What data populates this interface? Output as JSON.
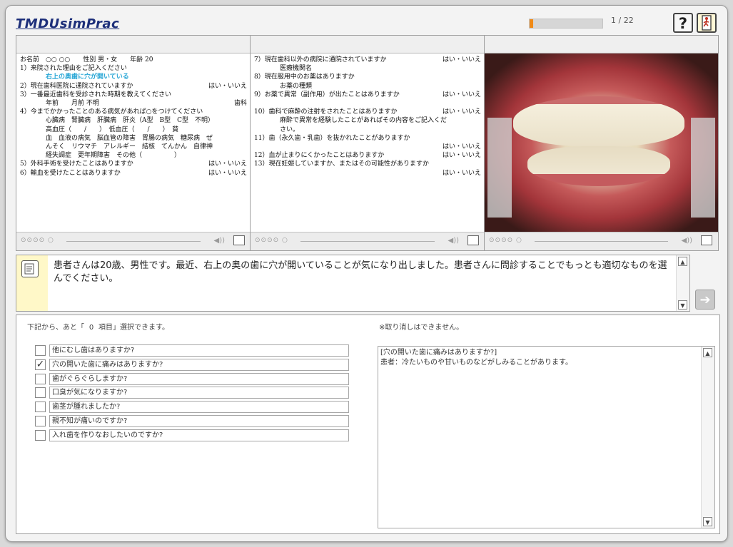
{
  "app": {
    "logo": "TMDUsimPrac",
    "progress_fraction": 0.045,
    "page_counter": "1 / 22",
    "help_icon": "?",
    "exit_icon": "exit-door-icon"
  },
  "media": {
    "controls_glyphs": "⊙⊙⊙⊙ ○",
    "volume_glyph": "◀))",
    "panels": [
      {
        "form_lines": [
          {
            "text": "お名前　○○ ○○　　性別 男・女　　年齢 20"
          },
          {
            "text": "1）来院された理由をご記入ください"
          },
          {
            "text": "右上の奥歯に穴が開いている",
            "hand": true,
            "indent": true
          },
          {
            "text": "2）現在歯科医院に通院されていますか",
            "right": "はい・いいえ"
          },
          {
            "text": "3）一番最近歯科を受診された時期を教えてください"
          },
          {
            "text": "年前　　月前 不明",
            "indent": true,
            "right": "歯科"
          },
          {
            "text": "4）今までかかったことのある病気があれば○をつけてください"
          },
          {
            "text": "心臓病　腎臓病　肝臓病　肝炎（A型　B型　C型　不明）",
            "indent": true
          },
          {
            "text": "高血圧（　　/　　）　低血圧（　　/　　）　貧",
            "indent": true
          },
          {
            "text": "血　血液の病気　脳血管の障害　胃腸の病気　糖尿病　ぜ",
            "indent": true
          },
          {
            "text": "んそく　リウマチ　アレルギー　結核　てんかん　自律神",
            "indent": true
          },
          {
            "text": "経失調症　更年期障害　その他（　　　　　）",
            "indent": true
          },
          {
            "text": "5）外科手術を受けたことはありますか",
            "right": "はい・いいえ"
          },
          {
            "text": "6）輸血を受けたことはありますか",
            "right": "はい・いいえ"
          }
        ]
      },
      {
        "form_lines": [
          {
            "text": "7）現在歯科以外の病院に通院されていますか",
            "right": "はい・いいえ"
          },
          {
            "text": "医療機関名",
            "indent": true
          },
          {
            "text": "8）現在服用中のお薬はありますか"
          },
          {
            "text": "お薬の種類",
            "indent": true
          },
          {
            "text": "9）お薬で異常（副作用）が出たことはありますか",
            "right": "はい・いいえ"
          },
          {
            "text": ""
          },
          {
            "text": "10）歯科で麻酔の注射をされたことはありますか",
            "right": "はい・いいえ"
          },
          {
            "text": "麻酔で異常を経験したことがあればその内容をご記入くだ",
            "indent": true
          },
          {
            "text": "さい。",
            "indent": true
          },
          {
            "text": "11）歯（永久歯・乳歯）を抜かれたことがありますか"
          },
          {
            "text": "",
            "right": "はい・いいえ"
          },
          {
            "text": "12）血が止まりにくかったことはありますか",
            "right": "はい・いいえ"
          },
          {
            "text": "13）現在妊娠していますか、またはその可能性がありますか"
          },
          {
            "text": "",
            "right": "はい・いいえ"
          }
        ]
      }
    ]
  },
  "instruction": {
    "text": "患者さんは20歳、男性です。最近、右上の奥の歯に穴が開いていることが気になり出しました。患者さんに問診することでもっとも適切なものを選んでください。",
    "next_glyph": "➔"
  },
  "selection": {
    "remaining_prefix": "下記から、あと「",
    "remaining_count": "0",
    "remaining_suffix": "項目」選択できます。",
    "notice": "※取り消しはできません。",
    "options": [
      {
        "label": "他にむし歯はありますか?",
        "checked": false
      },
      {
        "label": "穴の開いた歯に痛みはありますか?",
        "checked": true
      },
      {
        "label": "歯がぐらぐらしますか?",
        "checked": false
      },
      {
        "label": "口臭が気になりますか?",
        "checked": false
      },
      {
        "label": "歯茎が腫れましたか?",
        "checked": false
      },
      {
        "label": "親不知が痛いのですか?",
        "checked": false
      },
      {
        "label": "入れ歯を作りなおしたいのですか?",
        "checked": false
      }
    ],
    "log": {
      "question": "[穴の開いた歯に痛みはありますか?]",
      "answer": "患者：冷たいものや甘いものなどがしみることがあります。"
    }
  }
}
